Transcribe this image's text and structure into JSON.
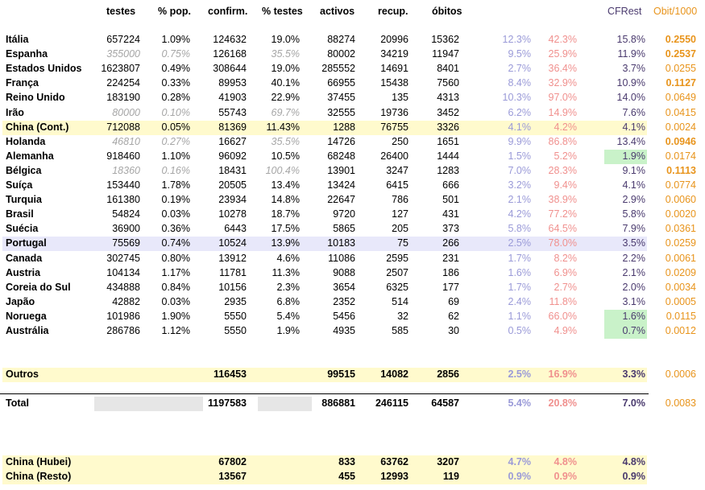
{
  "headers": {
    "testes": "testes",
    "pop": "% pop.",
    "confirm": "confirm.",
    "ptestes": "% testes",
    "activos": "activos",
    "recup": "recup.",
    "obitos": "óbitos",
    "cfrest": "CFRest",
    "obit1000": "Obit/1000"
  },
  "colors": {
    "yellow": "#fffacd",
    "lavender": "#e8e8fa",
    "green": "#c9f2c9",
    "gray_cell": "#e6e6e6",
    "col_a": "#9a9ad8",
    "col_b": "#f0908e",
    "col_c": "#4a3a6e",
    "col_d": "#e8941c"
  },
  "countries": [
    {
      "name": "Itália",
      "testes": "657224",
      "pop": "1.09%",
      "confirm": "124632",
      "ptestes": "19.0%",
      "activos": "88274",
      "recup": "20996",
      "obitos": "15362",
      "a": "12.3%",
      "b": "42.3%",
      "c": "15.8%",
      "d": "0.2550",
      "d_bold": true,
      "italic": false,
      "hl": "",
      "green": false
    },
    {
      "name": "Espanha",
      "testes": "355000",
      "pop": "0.75%",
      "confirm": "126168",
      "ptestes": "35.5%",
      "activos": "80002",
      "recup": "34219",
      "obitos": "11947",
      "a": "9.5%",
      "b": "25.9%",
      "c": "11.9%",
      "d": "0.2537",
      "d_bold": true,
      "italic": true,
      "hl": "",
      "green": false
    },
    {
      "name": "Estados Unidos",
      "testes": "1623807",
      "pop": "0.49%",
      "confirm": "308644",
      "ptestes": "19.0%",
      "activos": "285552",
      "recup": "14691",
      "obitos": "8401",
      "a": "2.7%",
      "b": "36.4%",
      "c": "3.7%",
      "d": "0.0255",
      "d_bold": false,
      "italic": false,
      "hl": "",
      "green": false
    },
    {
      "name": "França",
      "testes": "224254",
      "pop": "0.33%",
      "confirm": "89953",
      "ptestes": "40.1%",
      "activos": "66955",
      "recup": "15438",
      "obitos": "7560",
      "a": "8.4%",
      "b": "32.9%",
      "c": "10.9%",
      "d": "0.1127",
      "d_bold": true,
      "italic": false,
      "hl": "",
      "green": false
    },
    {
      "name": "Reino Unido",
      "testes": "183190",
      "pop": "0.28%",
      "confirm": "41903",
      "ptestes": "22.9%",
      "activos": "37455",
      "recup": "135",
      "obitos": "4313",
      "a": "10.3%",
      "b": "97.0%",
      "c": "14.0%",
      "d": "0.0649",
      "d_bold": false,
      "italic": false,
      "hl": "",
      "green": false
    },
    {
      "name": "Irão",
      "testes": "80000",
      "pop": "0.10%",
      "confirm": "55743",
      "ptestes": "69.7%",
      "activos": "32555",
      "recup": "19736",
      "obitos": "3452",
      "a": "6.2%",
      "b": "14.9%",
      "c": "7.6%",
      "d": "0.0415",
      "d_bold": false,
      "italic": true,
      "hl": "",
      "green": false
    },
    {
      "name": "China (Cont.)",
      "testes": "712088",
      "pop": "0.05%",
      "confirm": "81369",
      "ptestes": "11.43%",
      "activos": "1288",
      "recup": "76755",
      "obitos": "3326",
      "a": "4.1%",
      "b": "4.2%",
      "c": "4.1%",
      "d": "0.0024",
      "d_bold": false,
      "italic": false,
      "hl": "yellow",
      "green": false
    },
    {
      "name": "Holanda",
      "testes": "46810",
      "pop": "0.27%",
      "confirm": "16627",
      "ptestes": "35.5%",
      "activos": "14726",
      "recup": "250",
      "obitos": "1651",
      "a": "9.9%",
      "b": "86.8%",
      "c": "13.4%",
      "d": "0.0946",
      "d_bold": true,
      "italic": true,
      "hl": "",
      "green": false
    },
    {
      "name": "Alemanha",
      "testes": "918460",
      "pop": "1.10%",
      "confirm": "96092",
      "ptestes": "10.5%",
      "activos": "68248",
      "recup": "26400",
      "obitos": "1444",
      "a": "1.5%",
      "b": "5.2%",
      "c": "1.9%",
      "d": "0.0174",
      "d_bold": false,
      "italic": false,
      "hl": "",
      "green": true
    },
    {
      "name": "Bélgica",
      "testes": "18360",
      "pop": "0.16%",
      "confirm": "18431",
      "ptestes": "100.4%",
      "activos": "13901",
      "recup": "3247",
      "obitos": "1283",
      "a": "7.0%",
      "b": "28.3%",
      "c": "9.1%",
      "d": "0.1113",
      "d_bold": true,
      "italic": true,
      "hl": "",
      "green": false
    },
    {
      "name": "Suíça",
      "testes": "153440",
      "pop": "1.78%",
      "confirm": "20505",
      "ptestes": "13.4%",
      "activos": "13424",
      "recup": "6415",
      "obitos": "666",
      "a": "3.2%",
      "b": "9.4%",
      "c": "4.1%",
      "d": "0.0774",
      "d_bold": false,
      "italic": false,
      "hl": "",
      "green": false
    },
    {
      "name": "Turquia",
      "testes": "161380",
      "pop": "0.19%",
      "confirm": "23934",
      "ptestes": "14.8%",
      "activos": "22647",
      "recup": "786",
      "obitos": "501",
      "a": "2.1%",
      "b": "38.9%",
      "c": "2.9%",
      "d": "0.0060",
      "d_bold": false,
      "italic": false,
      "hl": "",
      "green": false
    },
    {
      "name": "Brasil",
      "testes": "54824",
      "pop": "0.03%",
      "confirm": "10278",
      "ptestes": "18.7%",
      "activos": "9720",
      "recup": "127",
      "obitos": "431",
      "a": "4.2%",
      "b": "77.2%",
      "c": "5.8%",
      "d": "0.0020",
      "d_bold": false,
      "italic": false,
      "hl": "",
      "green": false
    },
    {
      "name": "Suécia",
      "testes": "36900",
      "pop": "0.36%",
      "confirm": "6443",
      "ptestes": "17.5%",
      "activos": "5865",
      "recup": "205",
      "obitos": "373",
      "a": "5.8%",
      "b": "64.5%",
      "c": "7.9%",
      "d": "0.0361",
      "d_bold": false,
      "italic": false,
      "hl": "",
      "green": false
    },
    {
      "name": "Portugal",
      "testes": "75569",
      "pop": "0.74%",
      "confirm": "10524",
      "ptestes": "13.9%",
      "activos": "10183",
      "recup": "75",
      "obitos": "266",
      "a": "2.5%",
      "b": "78.0%",
      "c": "3.5%",
      "d": "0.0259",
      "d_bold": false,
      "italic": false,
      "hl": "lavender",
      "green": false
    },
    {
      "name": "Canada",
      "testes": "302745",
      "pop": "0.80%",
      "confirm": "13912",
      "ptestes": "4.6%",
      "activos": "11086",
      "recup": "2595",
      "obitos": "231",
      "a": "1.7%",
      "b": "8.2%",
      "c": "2.2%",
      "d": "0.0061",
      "d_bold": false,
      "italic": false,
      "hl": "",
      "green": false
    },
    {
      "name": "Austria",
      "testes": "104134",
      "pop": "1.17%",
      "confirm": "11781",
      "ptestes": "11.3%",
      "activos": "9088",
      "recup": "2507",
      "obitos": "186",
      "a": "1.6%",
      "b": "6.9%",
      "c": "2.1%",
      "d": "0.0209",
      "d_bold": false,
      "italic": false,
      "hl": "",
      "green": false
    },
    {
      "name": "Coreia do Sul",
      "testes": "434888",
      "pop": "0.84%",
      "confirm": "10156",
      "ptestes": "2.3%",
      "activos": "3654",
      "recup": "6325",
      "obitos": "177",
      "a": "1.7%",
      "b": "2.7%",
      "c": "2.0%",
      "d": "0.0034",
      "d_bold": false,
      "italic": false,
      "hl": "",
      "green": false
    },
    {
      "name": "Japão",
      "testes": "42882",
      "pop": "0.03%",
      "confirm": "2935",
      "ptestes": "6.8%",
      "activos": "2352",
      "recup": "514",
      "obitos": "69",
      "a": "2.4%",
      "b": "11.8%",
      "c": "3.1%",
      "d": "0.0005",
      "d_bold": false,
      "italic": false,
      "hl": "",
      "green": false
    },
    {
      "name": "Noruega",
      "testes": "101986",
      "pop": "1.90%",
      "confirm": "5550",
      "ptestes": "5.4%",
      "activos": "5456",
      "recup": "32",
      "obitos": "62",
      "a": "1.1%",
      "b": "66.0%",
      "c": "1.6%",
      "d": "0.0115",
      "d_bold": false,
      "italic": false,
      "hl": "",
      "green": true
    },
    {
      "name": "Austrália",
      "testes": "286786",
      "pop": "1.12%",
      "confirm": "5550",
      "ptestes": "1.9%",
      "activos": "4935",
      "recup": "585",
      "obitos": "30",
      "a": "0.5%",
      "b": "4.9%",
      "c": "0.7%",
      "d": "0.0012",
      "d_bold": false,
      "italic": false,
      "hl": "",
      "green": true
    }
  ],
  "outros": {
    "name": "Outros",
    "confirm": "116453",
    "activos": "99515",
    "recup": "14082",
    "obitos": "2856",
    "a": "2.5%",
    "b": "16.9%",
    "c": "3.3%",
    "d": "0.0006"
  },
  "total": {
    "name": "Total",
    "confirm": "1197583",
    "activos": "886881",
    "recup": "246115",
    "obitos": "64587",
    "a": "5.4%",
    "b": "20.8%",
    "c": "7.0%",
    "d": "0.0083"
  },
  "china_hubei": {
    "name": "China (Hubei)",
    "confirm": "67802",
    "activos": "833",
    "recup": "63762",
    "obitos": "3207",
    "a": "4.7%",
    "b": "4.8%",
    "c": "4.8%"
  },
  "china_resto": {
    "name": "China (Resto)",
    "confirm": "13567",
    "activos": "455",
    "recup": "12993",
    "obitos": "119",
    "a": "0.9%",
    "b": "0.9%",
    "c": "0.9%"
  }
}
